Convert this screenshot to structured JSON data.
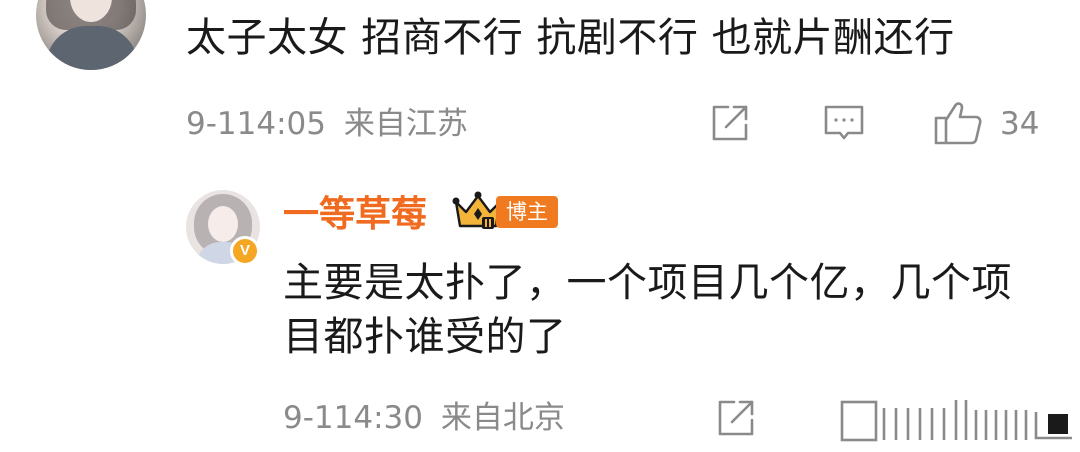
{
  "comment": {
    "text": "太子太女 招商不行 抗剧不行 也就片酬还行",
    "timestamp": "9-114:05",
    "location": "来自江苏",
    "like_count": "34",
    "icons": {
      "share": "share-icon",
      "reply": "reply-icon",
      "like": "thumbs-up-icon"
    }
  },
  "reply": {
    "username": "一等草莓",
    "name_color": "#f06a1f",
    "owner_tag": "博主",
    "verified_badge": "V",
    "text": "主要是太扑了，一个项目几个亿，几个项目都扑谁受的了",
    "timestamp": "9-114:30",
    "location": "来自北京",
    "icons": {
      "share": "share-icon",
      "reply": "reply-icon",
      "crown": "crown-icon"
    }
  },
  "colors": {
    "meta_text": "#8a8a8a",
    "accent": "#f07a1f",
    "badge": "#f5a623"
  }
}
